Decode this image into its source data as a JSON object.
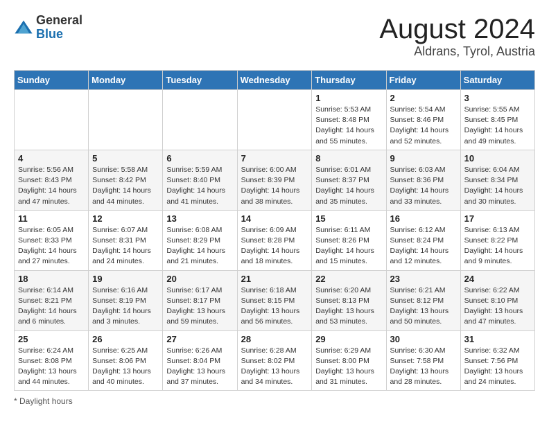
{
  "header": {
    "logo_general": "General",
    "logo_blue": "Blue",
    "month_year": "August 2024",
    "location": "Aldrans, Tyrol, Austria"
  },
  "days_of_week": [
    "Sunday",
    "Monday",
    "Tuesday",
    "Wednesday",
    "Thursday",
    "Friday",
    "Saturday"
  ],
  "weeks": [
    [
      {
        "day": "",
        "info": ""
      },
      {
        "day": "",
        "info": ""
      },
      {
        "day": "",
        "info": ""
      },
      {
        "day": "",
        "info": ""
      },
      {
        "day": "1",
        "info": "Sunrise: 5:53 AM\nSunset: 8:48 PM\nDaylight: 14 hours and 55 minutes."
      },
      {
        "day": "2",
        "info": "Sunrise: 5:54 AM\nSunset: 8:46 PM\nDaylight: 14 hours and 52 minutes."
      },
      {
        "day": "3",
        "info": "Sunrise: 5:55 AM\nSunset: 8:45 PM\nDaylight: 14 hours and 49 minutes."
      }
    ],
    [
      {
        "day": "4",
        "info": "Sunrise: 5:56 AM\nSunset: 8:43 PM\nDaylight: 14 hours and 47 minutes."
      },
      {
        "day": "5",
        "info": "Sunrise: 5:58 AM\nSunset: 8:42 PM\nDaylight: 14 hours and 44 minutes."
      },
      {
        "day": "6",
        "info": "Sunrise: 5:59 AM\nSunset: 8:40 PM\nDaylight: 14 hours and 41 minutes."
      },
      {
        "day": "7",
        "info": "Sunrise: 6:00 AM\nSunset: 8:39 PM\nDaylight: 14 hours and 38 minutes."
      },
      {
        "day": "8",
        "info": "Sunrise: 6:01 AM\nSunset: 8:37 PM\nDaylight: 14 hours and 35 minutes."
      },
      {
        "day": "9",
        "info": "Sunrise: 6:03 AM\nSunset: 8:36 PM\nDaylight: 14 hours and 33 minutes."
      },
      {
        "day": "10",
        "info": "Sunrise: 6:04 AM\nSunset: 8:34 PM\nDaylight: 14 hours and 30 minutes."
      }
    ],
    [
      {
        "day": "11",
        "info": "Sunrise: 6:05 AM\nSunset: 8:33 PM\nDaylight: 14 hours and 27 minutes."
      },
      {
        "day": "12",
        "info": "Sunrise: 6:07 AM\nSunset: 8:31 PM\nDaylight: 14 hours and 24 minutes."
      },
      {
        "day": "13",
        "info": "Sunrise: 6:08 AM\nSunset: 8:29 PM\nDaylight: 14 hours and 21 minutes."
      },
      {
        "day": "14",
        "info": "Sunrise: 6:09 AM\nSunset: 8:28 PM\nDaylight: 14 hours and 18 minutes."
      },
      {
        "day": "15",
        "info": "Sunrise: 6:11 AM\nSunset: 8:26 PM\nDaylight: 14 hours and 15 minutes."
      },
      {
        "day": "16",
        "info": "Sunrise: 6:12 AM\nSunset: 8:24 PM\nDaylight: 14 hours and 12 minutes."
      },
      {
        "day": "17",
        "info": "Sunrise: 6:13 AM\nSunset: 8:22 PM\nDaylight: 14 hours and 9 minutes."
      }
    ],
    [
      {
        "day": "18",
        "info": "Sunrise: 6:14 AM\nSunset: 8:21 PM\nDaylight: 14 hours and 6 minutes."
      },
      {
        "day": "19",
        "info": "Sunrise: 6:16 AM\nSunset: 8:19 PM\nDaylight: 14 hours and 3 minutes."
      },
      {
        "day": "20",
        "info": "Sunrise: 6:17 AM\nSunset: 8:17 PM\nDaylight: 13 hours and 59 minutes."
      },
      {
        "day": "21",
        "info": "Sunrise: 6:18 AM\nSunset: 8:15 PM\nDaylight: 13 hours and 56 minutes."
      },
      {
        "day": "22",
        "info": "Sunrise: 6:20 AM\nSunset: 8:13 PM\nDaylight: 13 hours and 53 minutes."
      },
      {
        "day": "23",
        "info": "Sunrise: 6:21 AM\nSunset: 8:12 PM\nDaylight: 13 hours and 50 minutes."
      },
      {
        "day": "24",
        "info": "Sunrise: 6:22 AM\nSunset: 8:10 PM\nDaylight: 13 hours and 47 minutes."
      }
    ],
    [
      {
        "day": "25",
        "info": "Sunrise: 6:24 AM\nSunset: 8:08 PM\nDaylight: 13 hours and 44 minutes."
      },
      {
        "day": "26",
        "info": "Sunrise: 6:25 AM\nSunset: 8:06 PM\nDaylight: 13 hours and 40 minutes."
      },
      {
        "day": "27",
        "info": "Sunrise: 6:26 AM\nSunset: 8:04 PM\nDaylight: 13 hours and 37 minutes."
      },
      {
        "day": "28",
        "info": "Sunrise: 6:28 AM\nSunset: 8:02 PM\nDaylight: 13 hours and 34 minutes."
      },
      {
        "day": "29",
        "info": "Sunrise: 6:29 AM\nSunset: 8:00 PM\nDaylight: 13 hours and 31 minutes."
      },
      {
        "day": "30",
        "info": "Sunrise: 6:30 AM\nSunset: 7:58 PM\nDaylight: 13 hours and 28 minutes."
      },
      {
        "day": "31",
        "info": "Sunrise: 6:32 AM\nSunset: 7:56 PM\nDaylight: 13 hours and 24 minutes."
      }
    ]
  ],
  "footer": {
    "daylight_label": "Daylight hours"
  }
}
